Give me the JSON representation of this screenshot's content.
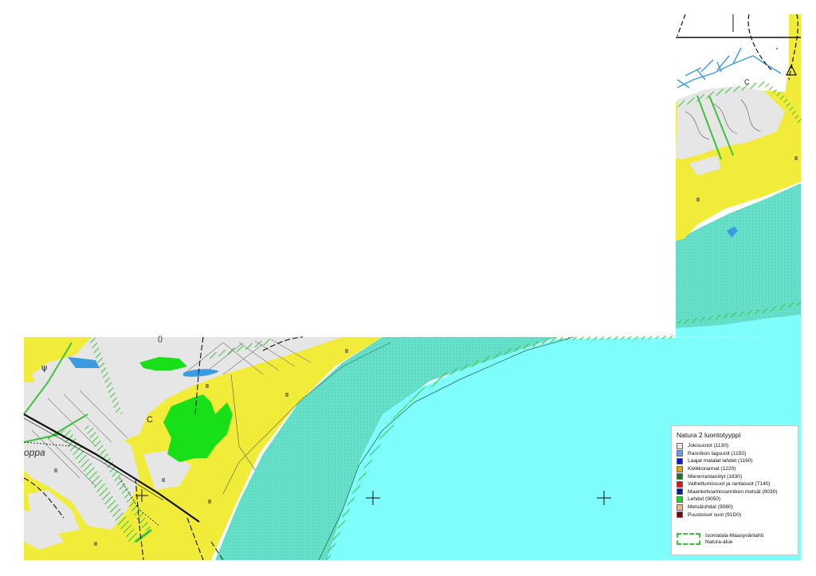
{
  "legend": {
    "title": "Natura 2 luontotyyppi",
    "items": [
      {
        "label": "Jokisuistot (1130)",
        "color": "#e6e6e6"
      },
      {
        "label": "Rannikon laguunit (1150)",
        "color": "#6f95ff"
      },
      {
        "label": "Laajat matalat lahdet (1160)",
        "color": "#1212c8"
      },
      {
        "label": "Kivikkorannat (1220)",
        "color": "#f0a000"
      },
      {
        "label": "Merenrantaniityt (1630)",
        "color": "#1e7a1e"
      },
      {
        "label": "Vaihettumissuot ja rantasuot (7140)",
        "color": "#e01010"
      },
      {
        "label": "Maankohoamisrannikon metsät (9030)",
        "color": "#0a1e8c"
      },
      {
        "label": "Lehdot (9050)",
        "color": "#18e018"
      },
      {
        "label": "Metsäluhdat (9080)",
        "color": "#f5b58c"
      },
      {
        "label": "Puustoiset suot (91D0)",
        "color": "#7a0a0a"
      }
    ],
    "area": {
      "line1": "Isomatala-Maasyvänlahti",
      "line2": "Natura-alue",
      "color": "#3cc23c"
    }
  },
  "map_labels": {
    "c1": "C",
    "c2": "C",
    "oppa": "oppa",
    "paren": "()"
  },
  "colors": {
    "sea": "#7ffcfc",
    "shore_band": "#66e0c8",
    "land_yellow": "#f1ec3a",
    "jokisuisto": "#e6e6e6",
    "lehdot": "#18e018",
    "natura_boundary": "#3cc23c",
    "stream": "#3a9be0"
  }
}
